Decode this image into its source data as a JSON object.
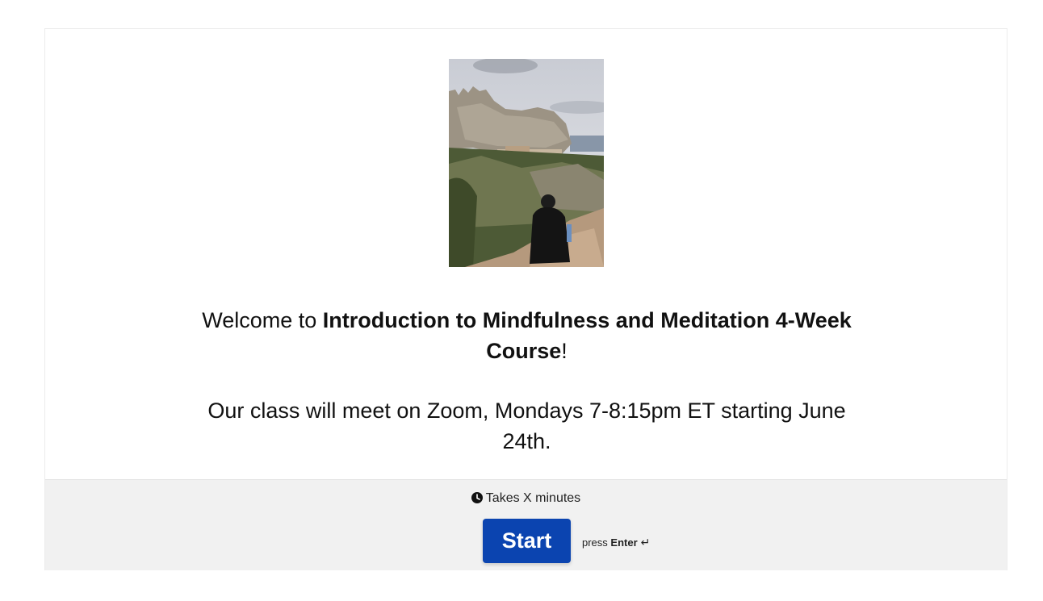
{
  "welcome": {
    "prefix": "Welcome to ",
    "course_name": "Introduction to Mindfulness and Meditation 4-Week Course",
    "suffix": "!"
  },
  "meeting_info": "Our class will meet on Zoom, Mondays 7-8:15pm ET starting June 24th.",
  "footer": {
    "duration_icon": "clock-icon",
    "duration_text": "Takes X minutes",
    "start_label": "Start",
    "hint_prefix": "press ",
    "hint_key": "Enter",
    "hint_icon": "enter-icon",
    "button_color": "#0b44b0"
  }
}
